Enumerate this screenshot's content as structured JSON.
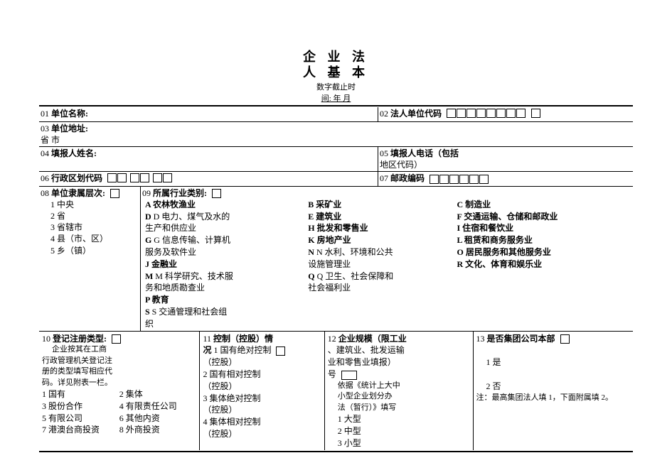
{
  "title1": "企 业 法",
  "title2": "人 基 本",
  "subtitle1": "数字截止时",
  "subtitle2": "间:   年 月",
  "f01": {
    "num": "01",
    "label": "单位名称:"
  },
  "f02": {
    "num": "02",
    "label": "法人单位代码"
  },
  "f03": {
    "num": "03",
    "label": "单位地址:",
    "line2": "省          市"
  },
  "f04": {
    "num": "04",
    "label": "填报人姓名:"
  },
  "f05": {
    "num": "05",
    "label": "填报人电话（包括",
    "line2": "地区代码）"
  },
  "f06": {
    "num": "06",
    "label": "行政区划代码"
  },
  "f07": {
    "num": "07",
    "label": "邮政编码"
  },
  "f08": {
    "num": "08",
    "label": "单位隶属层次:",
    "opts": [
      "1 中央",
      "2 省",
      "3 省辖市",
      "4 县（市、区）",
      "5 乡（镇）"
    ]
  },
  "f09": {
    "num": "09",
    "label": "所属行业类别:",
    "colA": [
      "A 农林牧渔业",
      "D 电力、煤气及水的",
      "生产和供应业",
      "G 信息传输、计算机",
      "服务及软件业",
      "J 金融业",
      "M 科学研究、技术服",
      "务和地质勘查业",
      "P 教育",
      "S 交通管理和社会组",
      "织"
    ],
    "colB": [
      "B 采矿业",
      "E 建筑业",
      "H 批发和零售业",
      "K 房地产业",
      "N 水利、环境和公共",
      "设施管理业",
      "Q 卫生、社会保障和",
      "社会福利业"
    ],
    "colC": [
      "C 制造业",
      "F 交通运输、仓储和邮政业",
      "I 住宿和餐饮业",
      "L 租赁和商务服务业",
      "O 居民服务和其他服务业",
      "R 文化、体育和娱乐业"
    ]
  },
  "f10": {
    "num": "10",
    "label": "登记注册类型:",
    "linesA": [
      "企业按其在工商",
      "行政管理机关登记注",
      "册的类型填写相应代",
      "码。详见附表一栏。"
    ],
    "optsL": [
      "1 国有",
      "3 股份合作",
      "5 有限公司",
      "7 港澳台商投资"
    ],
    "optsR": [
      "2 集体",
      "4 有限责任公司",
      "6 其他内资",
      "8 外商投资"
    ]
  },
  "f11": {
    "num": "11",
    "label": "控制（控股）情",
    "label2": "况",
    "opts": [
      "1 国有绝对控制",
      "（控股）",
      "2 国有相对控制",
      "（控股）",
      "3 集体绝对控制",
      "（控股）",
      "4 集体相对控制",
      "（控股）"
    ]
  },
  "f12": {
    "num": "12",
    "label": "企业规模（限工业",
    "lines": [
      "、建筑业、批发运输",
      "业和零售业填报）",
      "号",
      "依据《统计上大中",
      "小型企业划分办",
      "法（暂行）》填写"
    ],
    "opts": [
      "1 大型",
      "2 中型",
      "3 小型"
    ]
  },
  "f13": {
    "num": "13",
    "label": "是否集团公司本部",
    "opts": [
      "1 是",
      "2 否"
    ],
    "note": "注：最高集团法人填 1，下面附属填 2。"
  }
}
